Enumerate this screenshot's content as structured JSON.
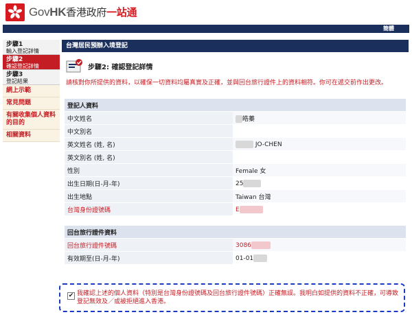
{
  "header": {
    "logo_gov": "Gov",
    "logo_hk": "HK",
    "logo_zh": "香港政府",
    "logo_zh_red": "一站通",
    "lang_link": "簡體"
  },
  "sidebar": {
    "steps": [
      {
        "num": "步驟1",
        "label": "輸入登記詳情"
      },
      {
        "num": "步驟2",
        "label": "確認登記詳情"
      },
      {
        "num": "步驟3",
        "label": "登記結果"
      }
    ],
    "links": [
      "網上示範",
      "常見問題",
      "有關收集個人資料的目的",
      "相關資料"
    ]
  },
  "main": {
    "title": "台灣居民預辦入境登記",
    "step_heading": "步驟2: 確認登記詳情",
    "note": "請核對你所提供的資料，以確保一切資料均屬真實及正確，並與回台旅行證件上的資料相符。你可在遞交前作出更改。"
  },
  "registrant": {
    "section_title": "登記人資料",
    "rows": [
      {
        "label": "中文姓名",
        "value": "皓蓁"
      },
      {
        "label": "中文別名",
        "value": ""
      },
      {
        "label": "英文姓名 (姓, 名)",
        "value": "JO-CHEN"
      },
      {
        "label": "英文別名 (姓, 名)",
        "value": ""
      },
      {
        "label": "性別",
        "value": "Female 女"
      },
      {
        "label": "出生日期(日-月-年)",
        "value": "25"
      },
      {
        "label": "出生地點",
        "value": "Taiwan 台灣"
      },
      {
        "label": "台灣身份證號碼",
        "value": "E"
      }
    ]
  },
  "travel_doc": {
    "section_title": "回台旅行證件資料",
    "rows": [
      {
        "label": "回台旅行證件號碼",
        "value": "3086"
      },
      {
        "label": "有效期至(日-月-年)",
        "value": "01-01"
      }
    ]
  },
  "declaration": {
    "checked": true,
    "check_mark": "✔",
    "text": "我確認上述的個人資料（特別是台灣身份證號碼及回台旅行證件號碼）正確無誤。我明白如提供的資料不正確，可導致登記無效及／或被拒絕進入香港。"
  },
  "colors": {
    "navy": "#1b2f5c",
    "accent_red": "#c41e24",
    "dashed_border": "#1a3bbf"
  }
}
